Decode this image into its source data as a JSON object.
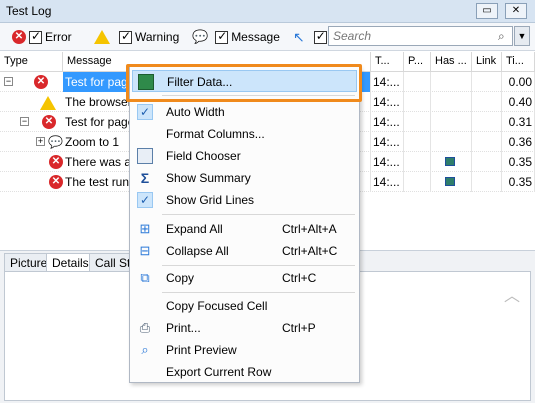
{
  "window": {
    "title": "Test Log",
    "btn_restore": "▭",
    "btn_close": "✕"
  },
  "toolbar": {
    "error_label": "Error",
    "warning_label": "Warning",
    "message_label": "Message",
    "search_placeholder": "Search",
    "search_dropdown": "▼"
  },
  "grid": {
    "columns": [
      "Type",
      "Message",
      "T...",
      "P...",
      "Has ...",
      "Link",
      "Ti..."
    ],
    "rows": [
      {
        "type": "error",
        "message": "Test for page",
        "time": "14:...",
        "ti": "0.00",
        "has_image": false,
        "selected": true
      },
      {
        "type": "warning",
        "message": "The browser",
        "time": "14:...",
        "ti": "0.40",
        "has_image": false,
        "selected": false
      },
      {
        "type": "error",
        "message": "Test for page",
        "time": "14:...",
        "ti": "0.31",
        "has_image": false,
        "selected": false
      },
      {
        "type": "message",
        "message": "Zoom to 1",
        "time": "14:...",
        "ti": "0.36",
        "has_image": false,
        "selected": false
      },
      {
        "type": "error",
        "message": "There was an",
        "time": "14:...",
        "ti": "0.35",
        "has_image": true,
        "selected": false
      },
      {
        "type": "error",
        "message": "The test run h",
        "time": "14:...",
        "ti": "0.35",
        "has_image": true,
        "selected": false
      }
    ]
  },
  "bottom_tabs": [
    "Picture",
    "Details",
    "Call Stac"
  ],
  "menu": {
    "filter_data": "Filter Data...",
    "auto_width": "Auto Width",
    "format_columns": "Format Columns...",
    "field_chooser": "Field Chooser",
    "show_summary": "Show Summary",
    "show_grid_lines": "Show Grid Lines",
    "expand_all": "Expand All",
    "expand_all_sc": "Ctrl+Alt+A",
    "collapse_all": "Collapse All",
    "collapse_all_sc": "Ctrl+Alt+C",
    "copy": "Copy",
    "copy_sc": "Ctrl+C",
    "copy_focused_cell": "Copy Focused Cell",
    "print": "Print...",
    "print_sc": "Ctrl+P",
    "print_preview": "Print Preview",
    "export_current_row": "Export Current Row"
  },
  "colors": {
    "highlight": "#cce5fb",
    "callout": "#f08a1c",
    "selected_row": "#3399ff",
    "error": "#d9282b",
    "warning": "#f5c400"
  }
}
